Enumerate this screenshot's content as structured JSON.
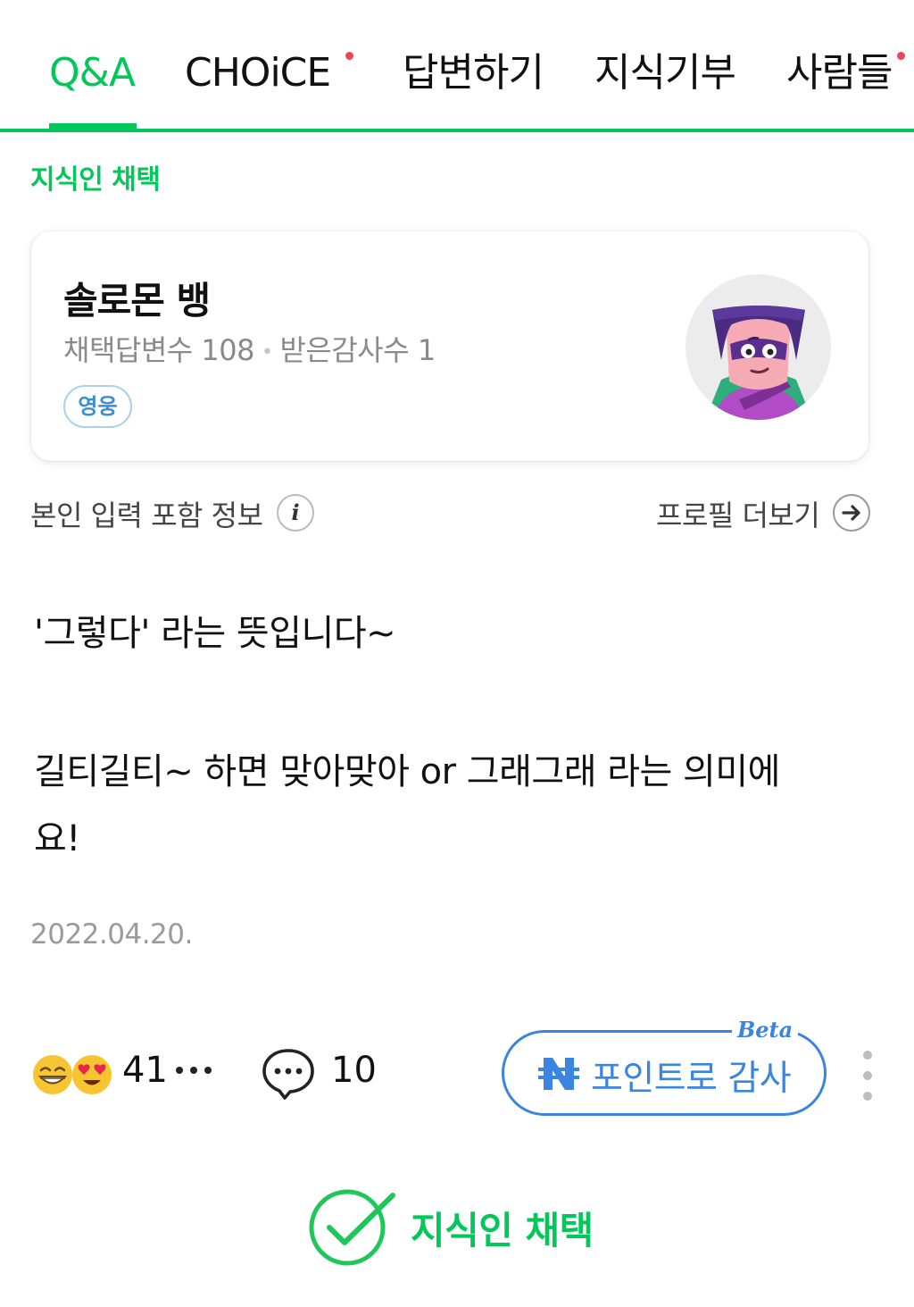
{
  "tabs": [
    {
      "label": "Q&A",
      "active": true,
      "new_dot": false
    },
    {
      "label": "CHOiCE",
      "active": false,
      "new_dot": true
    },
    {
      "label": "답변하기",
      "active": false,
      "new_dot": false
    },
    {
      "label": "지식기부",
      "active": false,
      "new_dot": false
    },
    {
      "label": "사람들",
      "active": false,
      "new_dot": true
    }
  ],
  "section_label": "지식인 채택",
  "profile": {
    "name": "솔로몬 뱅",
    "adopted_label": "채택답변수",
    "adopted_count": "108",
    "thanks_label": "받은감사수",
    "thanks_count": "1",
    "grade": "영웅"
  },
  "info": {
    "included_info": "본인 입력 포함 정보",
    "profile_more": "프로필 더보기"
  },
  "answer": {
    "line1": "'그렇다' 라는 뜻입니다~",
    "line2": "길티길티~ 하면 맞아맞아 or 그래그래 라는 의미에",
    "line3": "요!",
    "date": "2022.04.20."
  },
  "reactions": {
    "emojis": [
      "grinning-face-icon",
      "heart-eyes-face-icon"
    ],
    "count": "41",
    "comment_count": "10"
  },
  "point_button": {
    "label": "포인트로 감사",
    "beta": "Beta"
  },
  "adopted_badge": "지식인 채택",
  "colors": {
    "naver_green": "#03c75a",
    "point_blue": "#3a85e0",
    "badge_blue": "#3a8fd1",
    "notice_red": "#f0435a"
  }
}
